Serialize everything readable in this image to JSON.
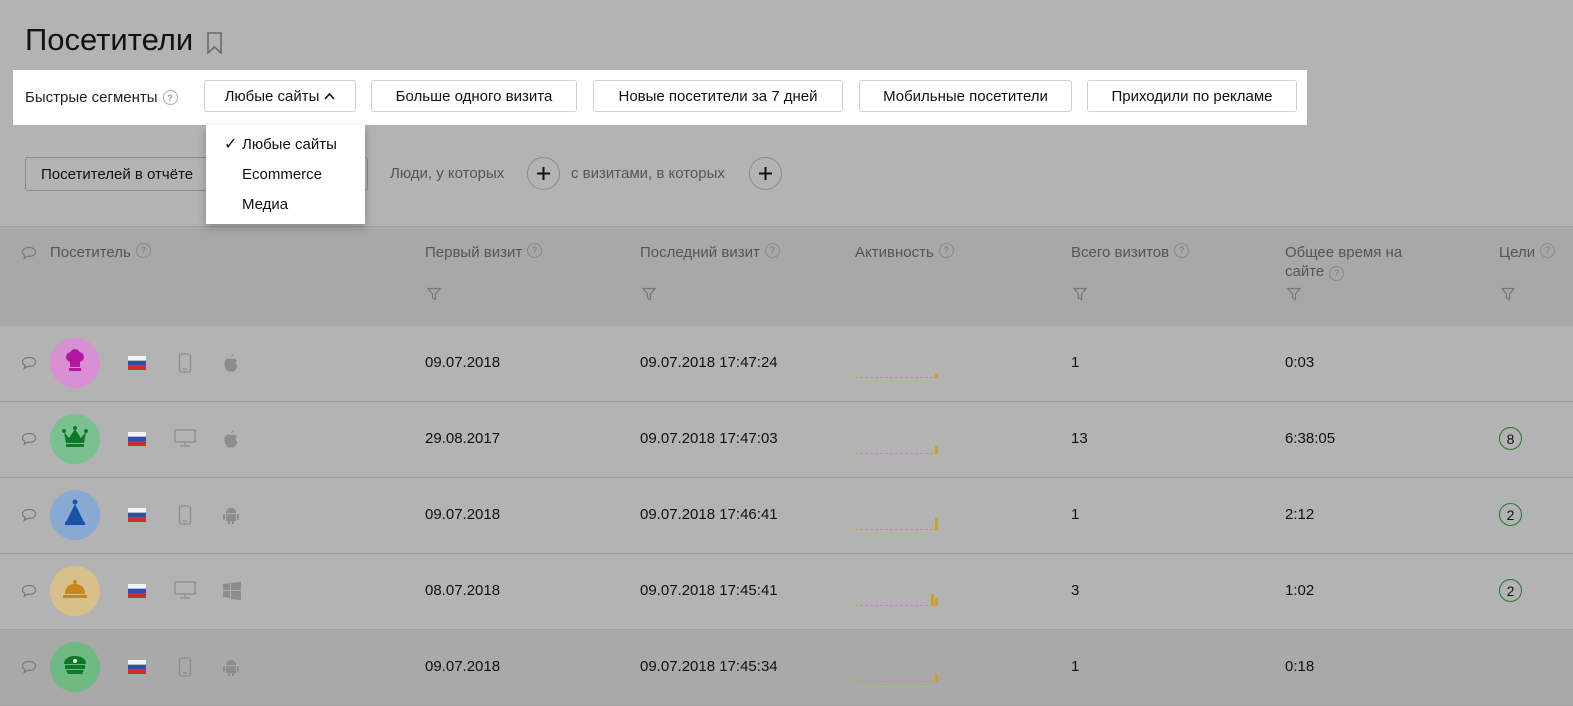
{
  "page": {
    "title": "Посетители"
  },
  "segments": {
    "label": "Быстрые сегменты",
    "buttons": [
      "Любые сайты",
      "Больше одного визита",
      "Новые посетители за 7 дней",
      "Мобильные посетители",
      "Приходили по рекламе"
    ],
    "dropdown": {
      "items": [
        "Любые сайты",
        "Ecommerce",
        "Медиа"
      ],
      "selected": "Любые сайты"
    }
  },
  "filters": {
    "report_button": "Посетителей в отчёте",
    "people_label": "Люди, у которых",
    "visits_label": "с визитами, в которых"
  },
  "table": {
    "columns": [
      "Посетитель",
      "Первый визит",
      "Последний визит",
      "Активность",
      "Всего визитов",
      "Общее время на сайте",
      "Цели"
    ],
    "rows": [
      {
        "avatar": "chef-hat-icon",
        "avatar_color": "#d88fd3",
        "icon_color": "#b2189e",
        "device": "mobile-icon",
        "os": "apple-icon",
        "first": "09.07.2018",
        "last": "09.07.2018 17:47:24",
        "activity": [
          0,
          0,
          0,
          0,
          0,
          0,
          0,
          0,
          0,
          0,
          0,
          0,
          0,
          0,
          0,
          0,
          0,
          1
        ],
        "visits": "1",
        "time": "0:03",
        "goals": ""
      },
      {
        "avatar": "crown-icon",
        "avatar_color": "#7bc08f",
        "icon_color": "#0c7a27",
        "device": "desktop-icon",
        "os": "apple-icon",
        "first": "29.08.2017",
        "last": "09.07.2018 17:47:03",
        "activity": [
          0,
          0,
          0,
          0,
          0,
          0,
          0,
          0,
          0,
          0,
          0,
          0,
          0,
          0,
          0,
          0,
          0,
          2
        ],
        "visits": "13",
        "time": "6:38:05",
        "goals": "8"
      },
      {
        "avatar": "party-hat-icon",
        "avatar_color": "#87a9d2",
        "icon_color": "#1b52a6",
        "device": "mobile-icon",
        "os": "android-icon",
        "first": "09.07.2018",
        "last": "09.07.2018 17:46:41",
        "activity": [
          0,
          0,
          0,
          0,
          0,
          0,
          0,
          0,
          0,
          0,
          0,
          0,
          0,
          0,
          0,
          0,
          0,
          3
        ],
        "visits": "1",
        "time": "2:12",
        "goals": "2"
      },
      {
        "avatar": "cloche-icon",
        "avatar_color": "#d8c08a",
        "icon_color": "#c8871e",
        "device": "desktop-icon",
        "os": "windows-icon",
        "first": "08.07.2018",
        "last": "09.07.2018 17:45:41",
        "activity": [
          0,
          0,
          0,
          0,
          0,
          0,
          0,
          0,
          0,
          0,
          0,
          0,
          0,
          0,
          0,
          0,
          3,
          2
        ],
        "visits": "3",
        "time": "1:02",
        "goals": "2"
      },
      {
        "avatar": "cap-icon",
        "avatar_color": "#6fb984",
        "icon_color": "#0c7a27",
        "device": "mobile-icon",
        "os": "android-icon",
        "first": "09.07.2018",
        "last": "09.07.2018 17:45:34",
        "activity": [
          0,
          0,
          0,
          0,
          0,
          0,
          0,
          0,
          0,
          0,
          0,
          0,
          0,
          0,
          0,
          0,
          0,
          2
        ],
        "visits": "1",
        "time": "0:18",
        "goals": ""
      }
    ]
  },
  "colors": {
    "accent": "#c9a227",
    "goal_border": "#1e7b2e"
  }
}
